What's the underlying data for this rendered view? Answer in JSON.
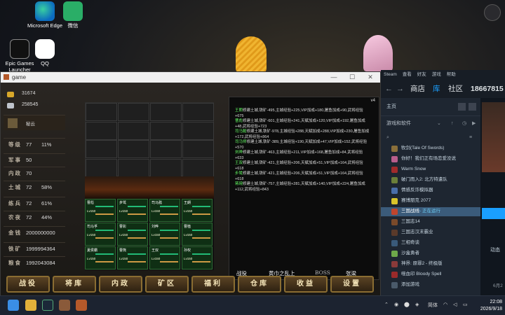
{
  "desktop": {
    "icons": [
      {
        "label": "Microsoft Edge"
      },
      {
        "label": "微信"
      },
      {
        "label": "Epic Games Launcher"
      },
      {
        "label": "QQ"
      }
    ]
  },
  "game": {
    "window_title": "game",
    "controls": {
      "minimize": "—",
      "maximize": "☐",
      "close": "✕"
    },
    "resources": [
      {
        "value": "31674"
      },
      {
        "value": "258545"
      }
    ],
    "hero": {
      "name": "秘云"
    },
    "stats": [
      {
        "label": "等级",
        "a": "77",
        "b": "11%"
      },
      {
        "label": "军事",
        "a": "50",
        "b": ""
      },
      {
        "label": "内政",
        "a": "70",
        "b": ""
      },
      {
        "label": "土城",
        "a": "72",
        "b": "58%"
      },
      {
        "label": "练兵",
        "a": "72",
        "b": "61%"
      },
      {
        "label": "农夜",
        "a": "72",
        "b": "44%"
      },
      {
        "label": "金钱",
        "a": "2000000000",
        "b": ""
      },
      {
        "label": "铁矿",
        "a": "1999994364",
        "b": ""
      },
      {
        "label": "粮食",
        "a": "1992043084",
        "b": ""
      }
    ],
    "hero_cards": [
      {
        "name": "曹彪",
        "lv": "Lv150"
      },
      {
        "name": "步骘",
        "lv": "Lv150"
      },
      {
        "name": "司马懿",
        "lv": "Lv150"
      },
      {
        "name": "王朗",
        "lv": "Lv150"
      },
      {
        "name": "司马孚",
        "lv": "Lv150"
      },
      {
        "name": "曹彰",
        "lv": "Lv150"
      },
      {
        "name": "刘晔",
        "lv": "Lv150"
      },
      {
        "name": "曹植",
        "lv": "Lv150"
      },
      {
        "name": "夏侯霸",
        "lv": "Lv150"
      },
      {
        "name": "曹熊",
        "lv": "Lv150"
      },
      {
        "name": "王双",
        "lv": "Lv150"
      },
      {
        "name": "孙权",
        "lv": "Lv150"
      }
    ],
    "log": {
      "version": "v4",
      "lines": [
        {
          "name": "王朗",
          "text": "修建土城,铁矿-495,主城经验+225,VIP加成+180,屠鱼加成+90,武将经验+675"
        },
        {
          "name": "曹彪",
          "text": "修建土城,铁矿-601,主城经验+241,天赋加成+120,VIP加成+192,屠鱼加成+48,武将经验+723"
        },
        {
          "name": "司马懿",
          "text": "修建土城,铁矿-978,主城经验+288,天赋加成+288,VIP加成+230,屠鱼加成+172,武将经验+864"
        },
        {
          "name": "司马师",
          "text": "修建土城,铁矿-389,主城经验+190,天赋加成+47,VIP加成+152,武将经验+570"
        },
        {
          "name": "刘晔",
          "text": "修建土城,铁矿-463,主城经验+211,VIP加成+168,屠鱼加成+84,武将经验+633"
        },
        {
          "name": "王双",
          "text": "修建土城,铁矿-421,主城经验+206,天赋加成+51,VIP加成+164,武将经验+618"
        },
        {
          "name": "步骘",
          "text": "修建土城,铁矿-421,主城经验+206,天赋加成+51,VIP加成+164,武将经验+618"
        },
        {
          "name": "蒋琬",
          "text": "修建土城,铁矿-757,主城经验+281,天赋加成+140,VIP加成+224,屠鱼加成+112,武将经验+843"
        }
      ],
      "footer": {
        "a": "战役",
        "b": "黄巾之乱上",
        "c": "BOSS",
        "d": "张梁"
      }
    },
    "buttons": [
      "战役",
      "将库",
      "内政",
      "矿区",
      "福利",
      "仓库",
      "收益",
      "设置"
    ]
  },
  "steam": {
    "topmenu": [
      "Steam",
      "查看",
      "好友",
      "游戏",
      "帮助"
    ],
    "nav": {
      "store": "商店",
      "library": "库",
      "community": "社区",
      "user": "18667815"
    },
    "home": "主页",
    "games_filter": "游戏和软件",
    "games": [
      {
        "name": "牧剑(Tale Of Swords)",
        "status": "",
        "color": "#8a6f3a"
      },
      {
        "name": "你好！我们正有场恋爱没说",
        "status": "",
        "color": "#b85e8c"
      },
      {
        "name": "Warm Snow",
        "status": "",
        "color": "#a12b2b"
      },
      {
        "name": "破门而入2: 北方特遣队",
        "status": "",
        "color": "#6b7f3a"
      },
      {
        "name": "情感反诈模拟器",
        "status": "",
        "color": "#4a6ea8"
      },
      {
        "name": "赛博朋克 2077",
        "status": "",
        "color": "#d9c42a"
      },
      {
        "name": "三国战线",
        "status": "- 正在运行",
        "color": "#c0452d"
      },
      {
        "name": "三国志14",
        "status": "",
        "color": "#7a4a2a"
      },
      {
        "name": "三国志汉末霸业",
        "status": "",
        "color": "#5a3a2a"
      },
      {
        "name": "三相奇谈",
        "status": "",
        "color": "#3a5a7a"
      },
      {
        "name": "沙盒勇者",
        "status": "",
        "color": "#6ea84a"
      },
      {
        "name": "神界: 原罪2 - 终极版",
        "status": "",
        "color": "#8a3a3a"
      },
      {
        "name": "噬血印 Bloody Spell",
        "status": "",
        "color": "#9a2a2a"
      },
      {
        "name": "添加游戏",
        "status": "",
        "color": "#4a5a6a"
      }
    ],
    "right": {
      "a": "动态",
      "b": "6月2"
    }
  },
  "taskbar": {
    "ime": "简体",
    "time": "22:08",
    "date": "2026/9/18"
  }
}
